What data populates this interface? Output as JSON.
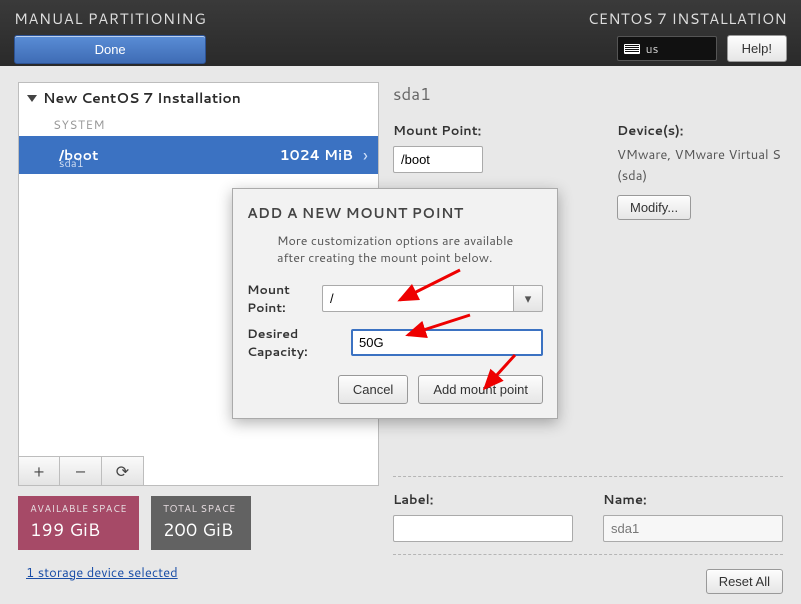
{
  "header": {
    "title": "MANUAL PARTITIONING",
    "install": "CENTOS 7 INSTALLATION",
    "done": "Done",
    "help": "Help!",
    "keyboard": "us"
  },
  "tree": {
    "root": "New CentOS 7 Installation",
    "section": "SYSTEM",
    "row": {
      "path": "/boot",
      "dev": "sda1",
      "size": "1024 MiB"
    }
  },
  "icons": {
    "add": "+",
    "remove": "–",
    "reload": "⟳"
  },
  "space": {
    "avail_label": "AVAILABLE SPACE",
    "avail_value": "199 GiB",
    "total_label": "TOTAL SPACE",
    "total_value": "200 GiB"
  },
  "storage_link": "1 storage device selected",
  "right": {
    "device_title": "sda1",
    "mount_label": "Mount Point:",
    "mount_value": "/boot",
    "devices_label": "Device(s):",
    "device_line1": "VMware, VMware Virtual S",
    "device_line2": "(sda)",
    "modify": "Modify...",
    "label_label": "Label:",
    "name_label": "Name:",
    "name_value": "sda1"
  },
  "reset": "Reset All",
  "modal": {
    "title": "ADD A NEW MOUNT POINT",
    "desc": "More customization options are available after creating the mount point below.",
    "mount_label": "Mount Point:",
    "mount_value": "/",
    "cap_label": "Desired Capacity:",
    "cap_value": "50G",
    "cancel": "Cancel",
    "add": "Add mount point"
  }
}
